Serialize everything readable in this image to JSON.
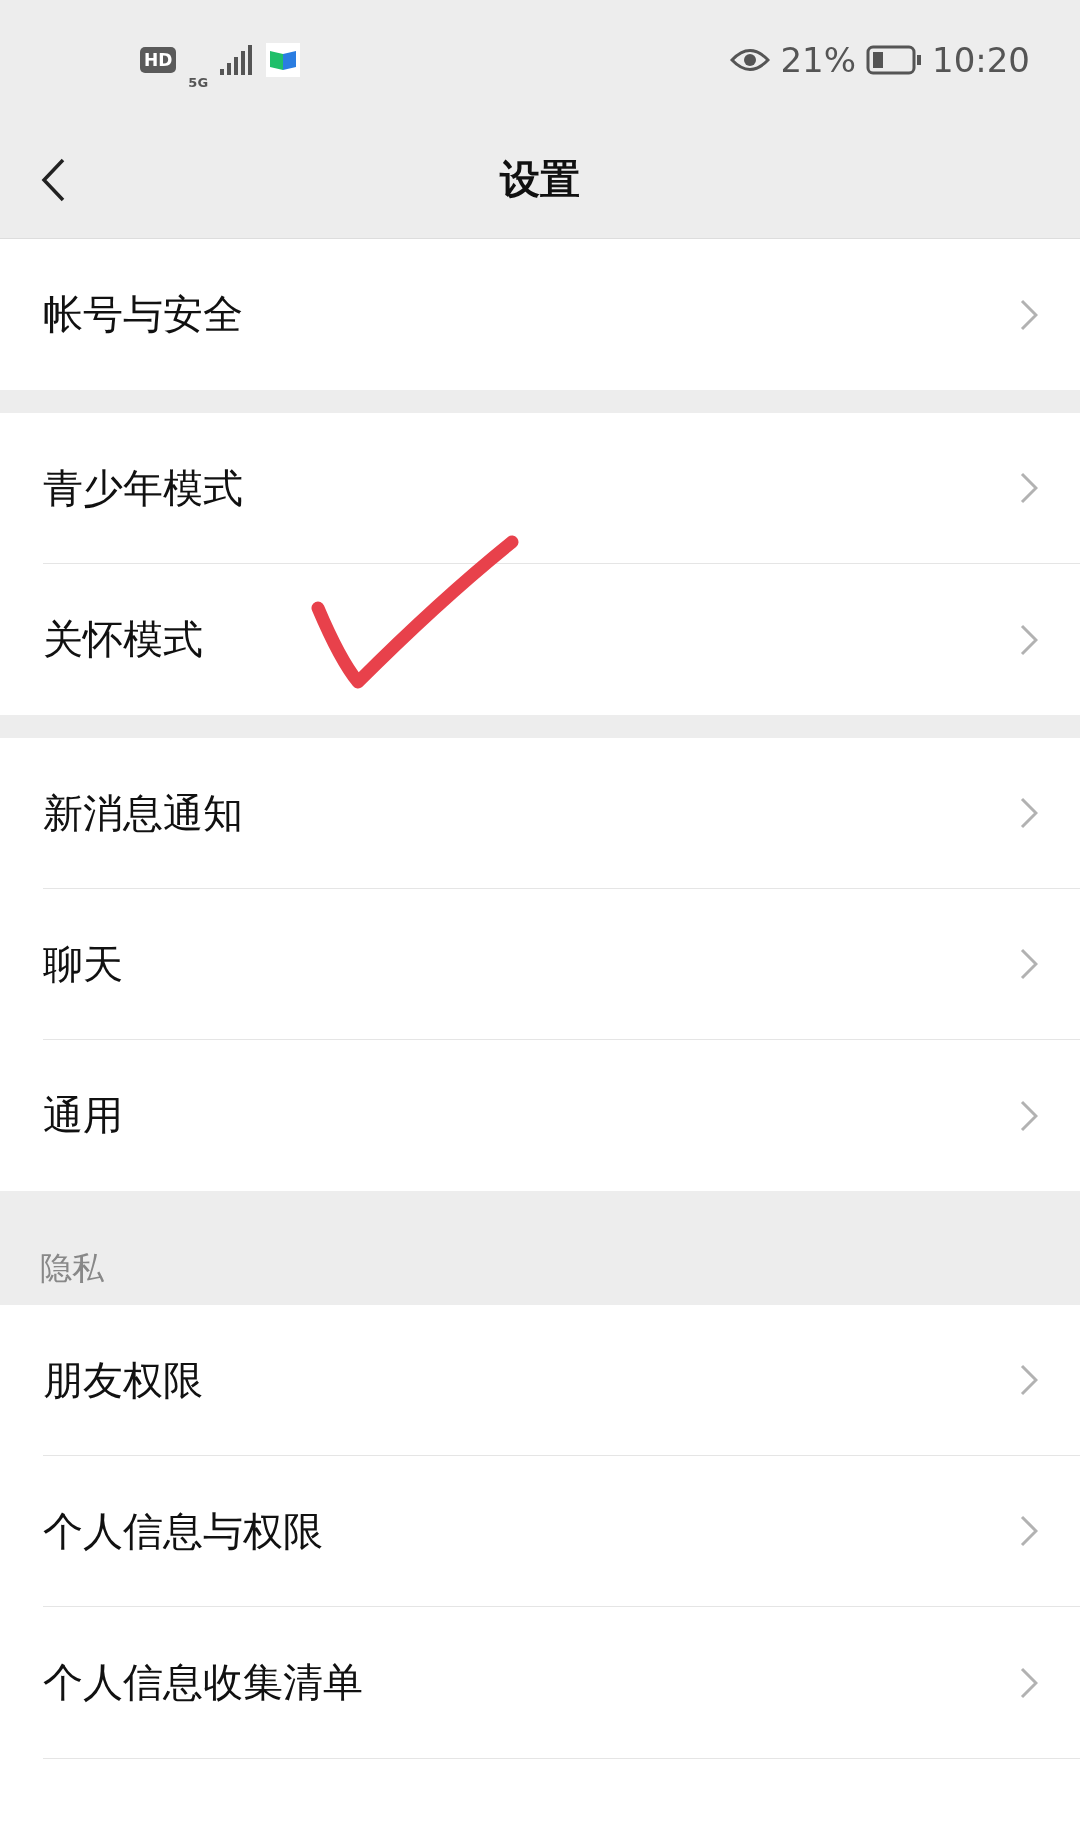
{
  "status_bar": {
    "hd_badge": "HD",
    "network": "5G",
    "battery_percent": "21%",
    "time": "10:20"
  },
  "nav_bar": {
    "title": "设置"
  },
  "sections": [
    {
      "kind": "group",
      "items": [
        {
          "label": "帐号与安全"
        }
      ]
    },
    {
      "kind": "group",
      "items": [
        {
          "label": "青少年模式"
        },
        {
          "label": "关怀模式"
        }
      ]
    },
    {
      "kind": "group",
      "items": [
        {
          "label": "新消息通知"
        },
        {
          "label": "聊天"
        },
        {
          "label": "通用"
        }
      ]
    },
    {
      "kind": "group",
      "header": "隐私",
      "items": [
        {
          "label": "朋友权限"
        },
        {
          "label": "个人信息与权限"
        },
        {
          "label": "个人信息收集清单"
        }
      ]
    }
  ]
}
